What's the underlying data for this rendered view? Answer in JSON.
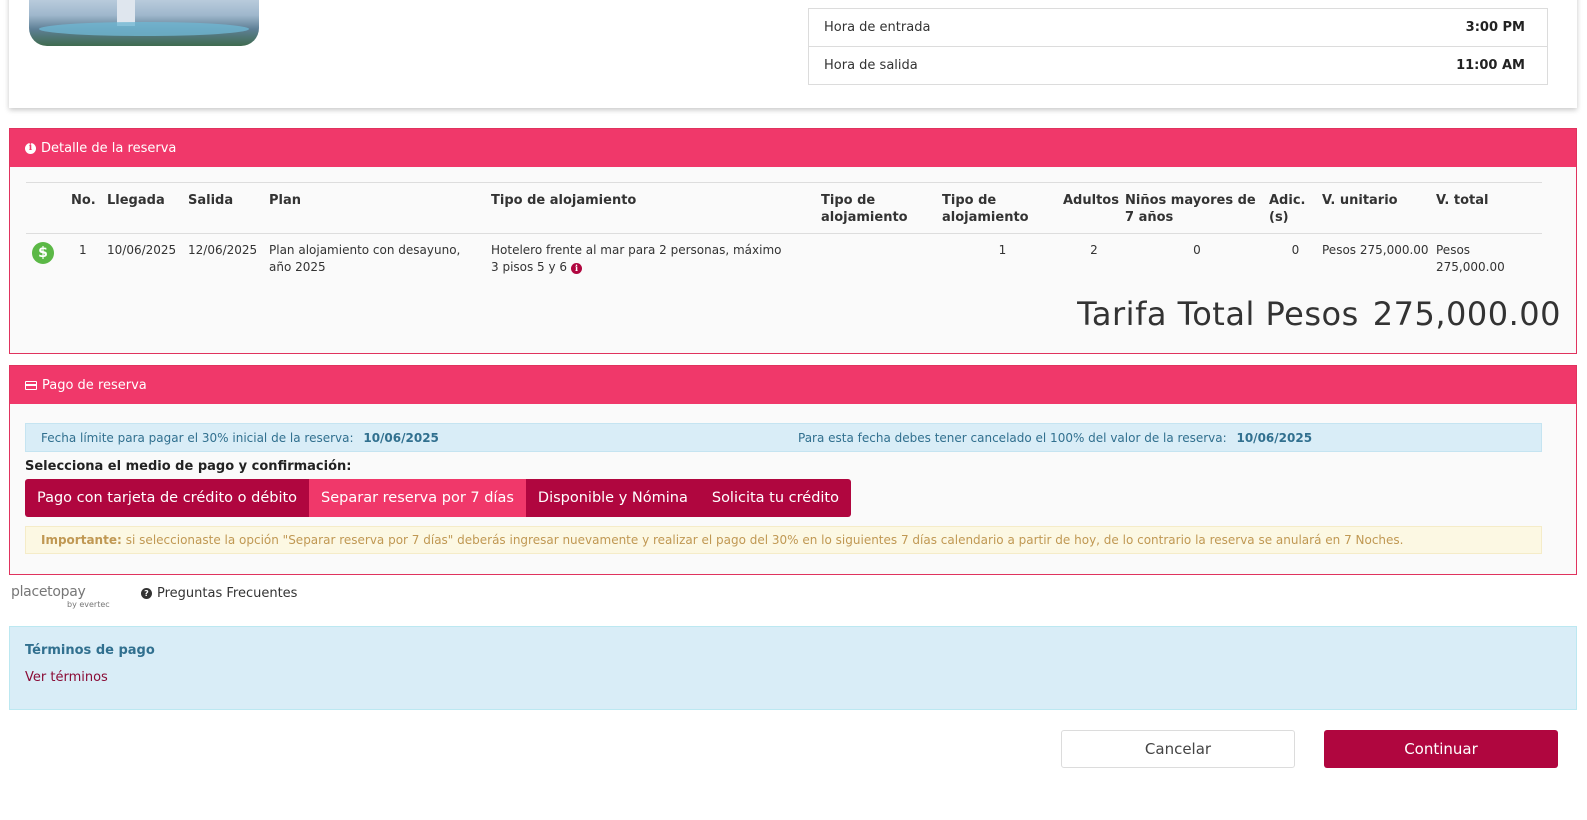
{
  "hotel": {
    "photo_icon": "hotel-photo",
    "info_rows": [
      {
        "label": "Hora de entrada",
        "value": "3:00 PM"
      },
      {
        "label": "Hora de salida",
        "value": "11:00 AM"
      }
    ]
  },
  "detail": {
    "header_icon": "info-circle-icon",
    "header": "Detalle de la reserva",
    "columns": [
      "No.",
      "Llegada",
      "Salida",
      "Plan",
      "Tipo de alojamiento",
      "Tipo de alojamiento",
      "Tipo de alojamiento",
      "Adultos",
      "Niños mayores de 7 años",
      "Adic. (s)",
      "V. unitario",
      "V. total"
    ],
    "row": {
      "status_icon": "dollar-circle-icon",
      "no": "1",
      "arrival": "10/06/2025",
      "departure": "12/06/2025",
      "plan": "Plan alojamiento con desayuno, año 2025",
      "room_type": "Hotelero frente al mar para 2 personas, máximo 3 pisos 5 y 6",
      "room_type_2": "",
      "room_type_3": "1",
      "adults": "2",
      "children": "0",
      "extra": "0",
      "unit_value": "Pesos 275,000.00",
      "total_value": "Pesos 275,000.00"
    },
    "total_label": "Tarifa Total Pesos",
    "total_amount": "275,000.00"
  },
  "payment": {
    "header_icon": "credit-card-icon",
    "header": "Pago de reserva",
    "deadline_30_label": "Fecha límite para pagar el 30% inicial de la reserva:",
    "deadline_30_date": "10/06/2025",
    "deadline_100_label": "Para esta fecha debes tener cancelado el 100% del valor de la reserva:",
    "deadline_100_date": "10/06/2025",
    "select_label": "Selecciona el medio de pago y confirmación:",
    "options": [
      {
        "label": "Pago con tarjeta de crédito o débito",
        "active": false
      },
      {
        "label": "Separar reserva por 7 días",
        "active": true
      },
      {
        "label": "Disponible y Nómina",
        "active": false
      },
      {
        "label": "Solicita tu crédito",
        "active": false
      }
    ],
    "important_label": "Importante:",
    "important_text": "si seleccionaste la opción \"Separar reserva por 7 días\" deberás ingresar nuevamente y realizar el pago del 30% en lo siguientes 7 días calendario a partir de hoy, de lo contrario la reserva se anulará en  7  Noches."
  },
  "footer": {
    "logo_text": "placetopay",
    "logo_sub": "by evertec",
    "faq_icon": "question-circle-icon",
    "faq_label": "Preguntas Frecuentes",
    "terms_title": "Términos de pago",
    "terms_link": "Ver términos",
    "cancel_label": "Cancelar",
    "continue_label": "Continuar"
  }
}
